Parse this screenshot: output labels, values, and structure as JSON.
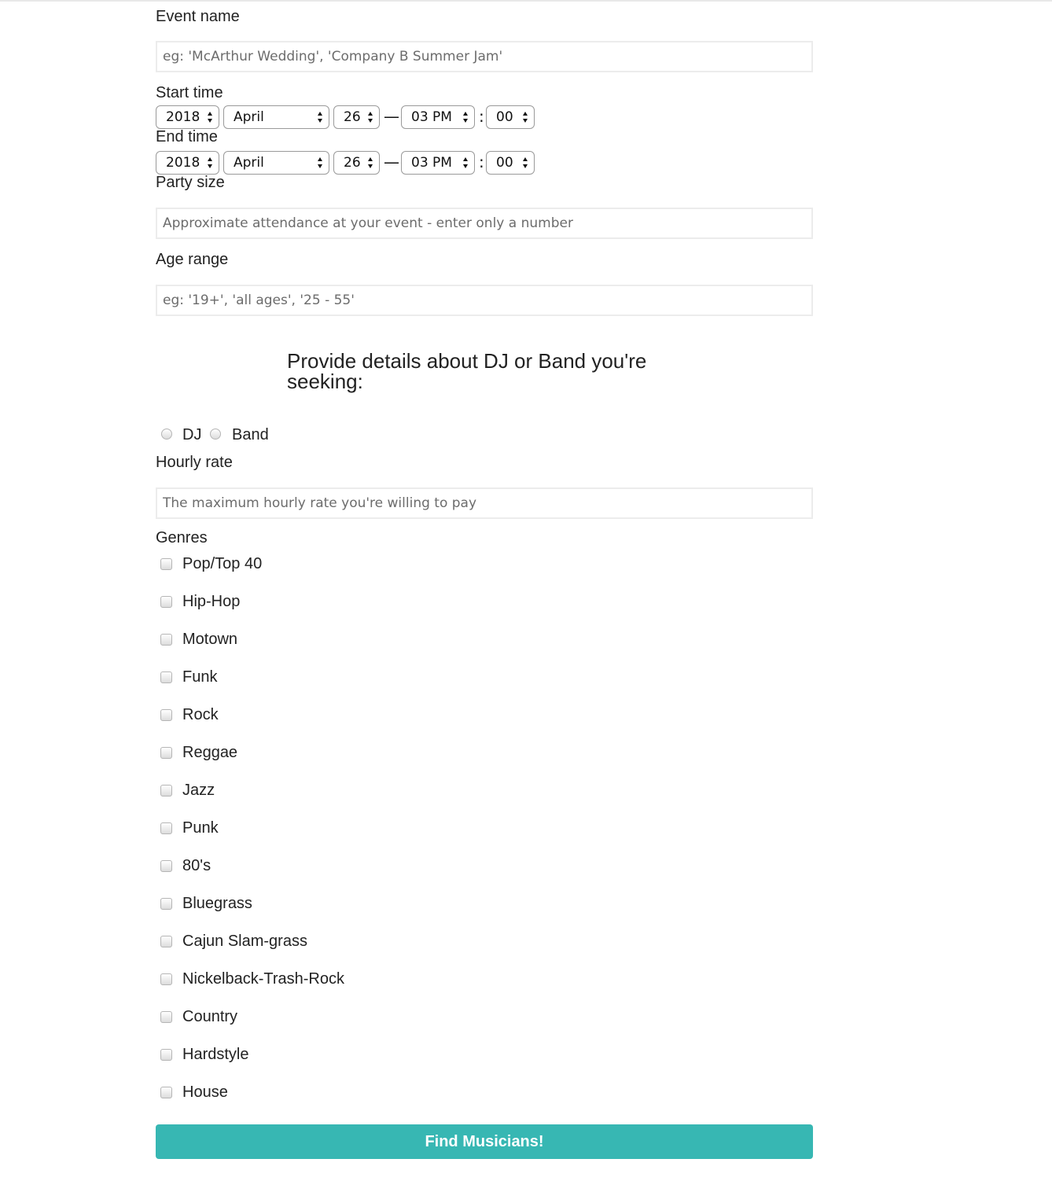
{
  "event_name": {
    "label": "Event name",
    "placeholder": "eg: 'McArthur Wedding', 'Company B Summer Jam'"
  },
  "start_time": {
    "label": "Start time",
    "year": "2018",
    "month": "April",
    "day": "26",
    "dash": "—",
    "hour": "03 PM",
    "colon": ":",
    "minute": "00"
  },
  "end_time": {
    "label": "End time",
    "year": "2018",
    "month": "April",
    "day": "26",
    "dash": "—",
    "hour": "03 PM",
    "colon": ":",
    "minute": "00"
  },
  "party_size": {
    "label": "Party size",
    "placeholder": "Approximate attendance at your event - enter only a number"
  },
  "age_range": {
    "label": "Age range",
    "placeholder": "eg: '19+', 'all ages', '25 - 55'"
  },
  "musician_section": {
    "heading": "Provide details about DJ or Band you're seeking:",
    "radio_options": [
      "DJ",
      "Band"
    ]
  },
  "hourly_rate": {
    "label": "Hourly rate",
    "placeholder": "The maximum hourly rate you're willing to pay"
  },
  "genres": {
    "label": "Genres",
    "options": [
      "Pop/Top 40",
      "Hip-Hop",
      "Motown",
      "Funk",
      "Rock",
      "Reggae",
      "Jazz",
      "Punk",
      "80's",
      "Bluegrass",
      "Cajun Slam-grass",
      "Nickelback-Trash-Rock",
      "Country",
      "Hardstyle",
      "House"
    ]
  },
  "submit_label": "Find Musicians!",
  "colors": {
    "button": "#37b7b3",
    "input_border": "#ececec",
    "select_border": "#9a9a9a"
  }
}
